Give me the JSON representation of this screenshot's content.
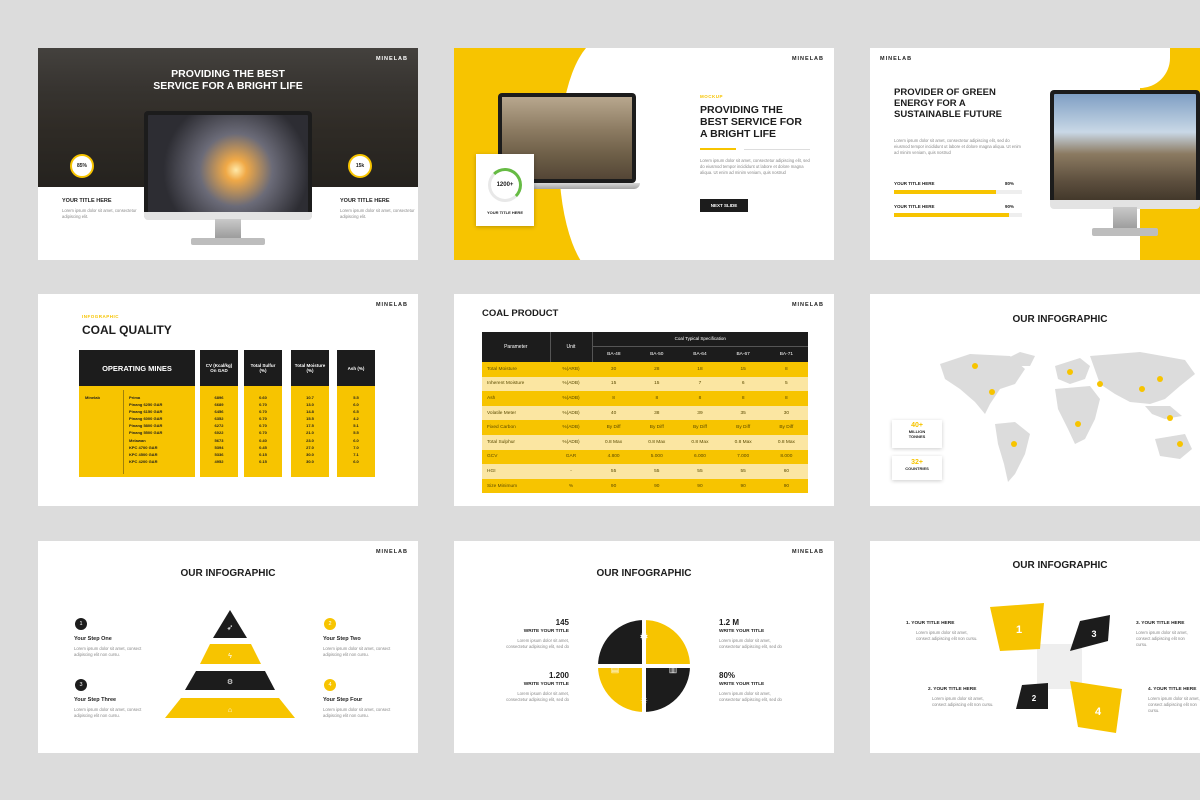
{
  "colors": {
    "accent": "#f7c400",
    "dark": "#1c1c1c"
  },
  "brand": "MINELAB",
  "s1": {
    "title_l1": "PROVIDING THE BEST",
    "title_l2": "SERVICE FOR A BRIGHT LIFE",
    "left_badge": "85%",
    "right_badge": "15k",
    "left_title": "YOUR TITLE HERE",
    "right_title": "YOUR TITLE HERE",
    "left_text": "Lorem ipsum dolor sit amet, consectetur adipiscing elit.",
    "right_text": "Lorem ipsum dolor sit amet, consectetur adipiscing elit."
  },
  "s2": {
    "kicker": "MOCKUP",
    "title_l1": "PROVIDING THE",
    "title_l2": "BEST SERVICE FOR",
    "title_l3": "A BRIGHT LIFE",
    "body": "Lorem ipsum dolor sit amet, consectetur adipiscing elit, sed do eiusmod tempor incididunt ut labore et dolore magna aliqua. Ut enim ad minim veniam, quis nostrud",
    "stat": "1200+",
    "stat_label": "YOUR TITLE HERE",
    "button": "NEXT SLIDE"
  },
  "s3": {
    "title_l1": "PROVIDER OF GREEN",
    "title_l2": "ENERGY FOR A",
    "title_l3": "SUSTAINABLE FUTURE",
    "body": "Lorem ipsum dolor sit amet, consectetur adipiscing elit, sed do eiusmod tempor incididunt ut labore et dolore magna aliqua. Ut enim ad minim veniam, quis nostrud",
    "bar1_label": "YOUR TITLE HERE",
    "bar1_value": "80%",
    "bar1_frac": 0.8,
    "bar2_label": "YOUR TITLE HERE",
    "bar2_value": "90%",
    "bar2_frac": 0.9
  },
  "s4": {
    "kicker": "INFOGRAPHIC",
    "title": "COAL QUALITY",
    "col_mines": "OPERATING MINES",
    "col_cv": "CV (Kcal/kg) On GAD",
    "col_sulfur": "Total Sulfur (%)",
    "col_moist": "Total Moisture (%)",
    "col_ash": "Ash (%)",
    "mine_name": "Minelab",
    "rows": [
      [
        "Prima",
        "6896",
        "0.60",
        "10.7",
        "5.5"
      ],
      [
        "Pinang 6250 GAR",
        "6689",
        "0.70",
        "13.0",
        "6.0"
      ],
      [
        "Pinang 6150 GAR",
        "6456",
        "0.70",
        "14.8",
        "6.5"
      ],
      [
        "Pinang 6000 GAR",
        "6352",
        "0.70",
        "15.5",
        "4.2"
      ],
      [
        "Pinang 5800 GAR",
        "6272",
        "0.70",
        "17.5",
        "5.1"
      ],
      [
        "Pinang 5500 GAR",
        "6022",
        "0.70",
        "21.0",
        "5.5"
      ],
      [
        "Melawan",
        "5673",
        "0.40",
        "23.0",
        "6.0"
      ],
      [
        "KPC 4700 GAR",
        "5394",
        "0.45",
        "27.0",
        "7.0"
      ],
      [
        "KPC 4500 GAR",
        "5336",
        "0.15",
        "30.0",
        "7.1"
      ],
      [
        "KPC 4200 GAR",
        "4952",
        "0.15",
        "30.0",
        "6.0"
      ]
    ]
  },
  "s5": {
    "title": "COAL PRODUCT",
    "h_param": "Parameter",
    "h_unit": "Unit",
    "h_spec": "Coal Typical Specification",
    "cols": [
      "BA-48",
      "BA-50",
      "BA-64",
      "BA-67",
      "BA-71"
    ],
    "rows": [
      [
        "Total Moisture",
        "%(ARB)",
        "30",
        "28",
        "18",
        "15",
        "8"
      ],
      [
        "Inherent Moisture",
        "%(ADB)",
        "15",
        "15",
        "7",
        "6",
        "5"
      ],
      [
        "Ash",
        "%(ADB)",
        "8",
        "8",
        "8",
        "8",
        "8"
      ],
      [
        "Volatile Meter",
        "%(ADB)",
        "40",
        "38",
        "39",
        "35",
        "30"
      ],
      [
        "Fixed Carbon",
        "%(ADB)",
        "By Diff",
        "By Diff",
        "By Diff",
        "By Diff",
        "By Diff"
      ],
      [
        "Total Sulphur",
        "%(ADB)",
        "0.8 Max",
        "0.8 Max",
        "0.8 Max",
        "0.8 Max",
        "0.8 Max"
      ],
      [
        "GCV",
        "GAR",
        "4.800",
        "5.000",
        "6.000",
        "7.000",
        "8.000"
      ],
      [
        "HGI",
        "-",
        "55",
        "55",
        "55",
        "55",
        "60"
      ],
      [
        "Size Minimum",
        "%",
        "90",
        "90",
        "90",
        "90",
        "90"
      ]
    ]
  },
  "s6": {
    "title": "OUR INFOGRAPHIC",
    "stat1_value": "40+",
    "stat1_label_l1": "MILLION",
    "stat1_label_l2": "TONNES",
    "stat2_value": "32+",
    "stat2_label": "COUNTRIES"
  },
  "s7": {
    "title": "OUR INFOGRAPHIC",
    "steps": [
      {
        "num": "1",
        "title": "Your Step One",
        "text": "Lorem ipsum dolor sit amet, consect adipiscing elit non cursu."
      },
      {
        "num": "2",
        "title": "Your Step Two",
        "text": "Lorem ipsum dolor sit amet, consect adipiscing elit non cursu."
      },
      {
        "num": "3",
        "title": "Your Step Three",
        "text": "Lorem ipsum dolor sit amet, consect adipiscing elit non cursu."
      },
      {
        "num": "4",
        "title": "Your Step Four",
        "text": "Lorem ipsum dolor sit amet, consect adipiscing elit non cursu."
      }
    ]
  },
  "s8": {
    "title": "OUR INFOGRAPHIC",
    "items": [
      {
        "value": "145",
        "title": "WRITE YOUR TITLE",
        "text": "Lorem ipsum dolor sit amet, consectetur adipiscing elit, sed do"
      },
      {
        "value": "1.2 M",
        "title": "WRITE YOUR TITLE",
        "text": "Lorem ipsum dolor sit amet, consectetur adipiscing elit, sed do"
      },
      {
        "value": "1.200",
        "title": "WRITE YOUR TITLE",
        "text": "Lorem ipsum dolor sit amet, consectetur adipiscing elit, sed do"
      },
      {
        "value": "80%",
        "title": "WRITE YOUR TITLE",
        "text": "Lorem ipsum dolor sit amet, consectetur adipiscing elit, sed do"
      }
    ]
  },
  "s9": {
    "title": "OUR INFOGRAPHIC",
    "items": [
      {
        "title": "1. YOUR TITLE HERE",
        "text": "Lorem ipsum dolor sit amet, consect adipiscing elit non cursu."
      },
      {
        "title": "3. YOUR TITLE HERE",
        "text": "Lorem ipsum dolor sit amet, consect adipiscing elit non cursu."
      },
      {
        "title": "2. YOUR TITLE HERE",
        "text": "Lorem ipsum dolor sit amet, consect adipiscing elit non cursu."
      },
      {
        "title": "4. YOUR TITLE HERE",
        "text": "Lorem ipsum dolor sit amet, consect adipiscing elit non cursu."
      }
    ],
    "nums": [
      "1",
      "2",
      "3",
      "4"
    ]
  }
}
